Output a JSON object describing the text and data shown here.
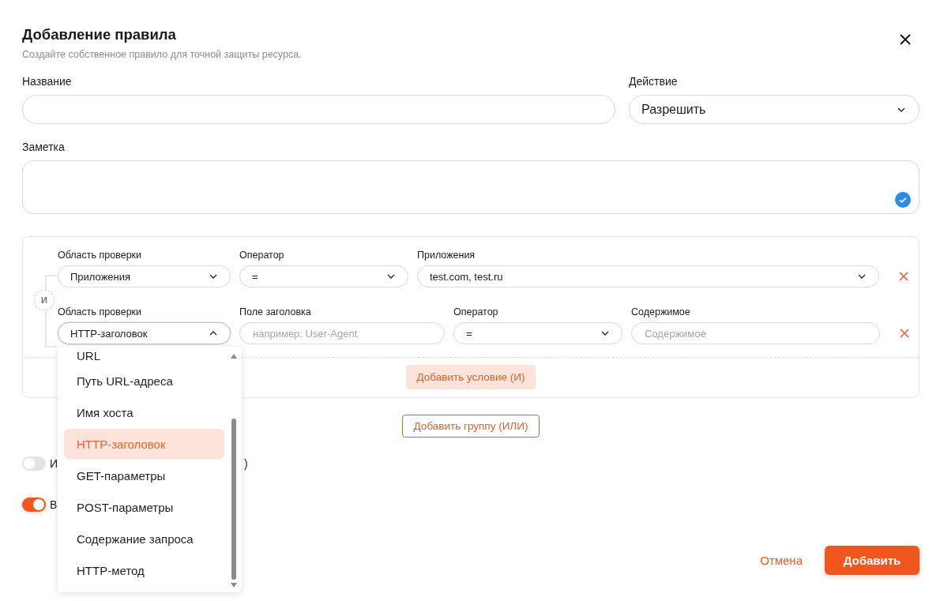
{
  "dialog": {
    "title": "Добавление правила",
    "subtitle": "Создайте собственное правило для точной защиты ресурса."
  },
  "name_field": {
    "label": "Название"
  },
  "action_field": {
    "label": "Действие",
    "value": "Разрешить"
  },
  "note_field": {
    "label": "Заметка"
  },
  "group": {
    "connector": "И",
    "add_condition": "Добавить условие (И)",
    "conditions": [
      {
        "fields": [
          {
            "kind": "select",
            "label": "Область проверки",
            "value": "Приложения",
            "open": false
          },
          {
            "kind": "select",
            "label": "Оператор",
            "value": "=",
            "open": false
          },
          {
            "kind": "select",
            "label": "Приложения",
            "value": "test.com, test.ru",
            "open": false
          }
        ]
      },
      {
        "fields": [
          {
            "kind": "select",
            "label": "Область проверки",
            "value": "HTTP-заголовок",
            "open": true
          },
          {
            "kind": "input",
            "label": "Поле заголовка",
            "placeholder": "например: User-Agent"
          },
          {
            "kind": "select",
            "label": "Оператор",
            "value": "=",
            "open": false
          },
          {
            "kind": "input",
            "label": "Содержимое",
            "placeholder": "Содержимое"
          }
        ]
      }
    ]
  },
  "add_group": "Добавить группу (ИЛИ)",
  "dropdown": {
    "options": [
      {
        "label": "URL",
        "selected": false
      },
      {
        "label": "Путь URL-адреса",
        "selected": false
      },
      {
        "label": "Имя хоста",
        "selected": false
      },
      {
        "label": "HTTP-заголовок",
        "selected": true
      },
      {
        "label": "GET-параметры",
        "selected": false
      },
      {
        "label": "POST-параметры",
        "selected": false
      },
      {
        "label": "Содержание запроса",
        "selected": false
      },
      {
        "label": "HTTP-метод",
        "selected": false
      }
    ]
  },
  "toggles": [
    {
      "on": false,
      "label": "И",
      "label_tail": ")"
    },
    {
      "on": true,
      "label": "В"
    }
  ],
  "buttons": {
    "cancel": "Отмена",
    "submit": "Добавить"
  }
}
